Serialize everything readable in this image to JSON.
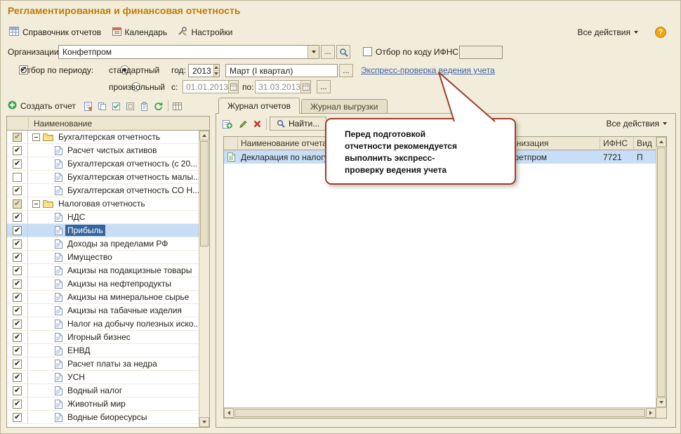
{
  "window": {
    "title": "Регламентированная и финансовая отчетность"
  },
  "top_toolbar": {
    "reports_catalog": "Справочник отчетов",
    "calendar": "Календарь",
    "settings": "Настройки",
    "all_actions": "Все действия",
    "help": "?"
  },
  "filters": {
    "org_label": "Организации:",
    "org_value": "Конфетпром",
    "ifns_check_label": "Отбор по коду ИФНС:",
    "ifns_value": "",
    "period_check_label": "Отбор по периоду:",
    "radio_standard": "стандартный",
    "radio_custom": "произвольный",
    "year_label": "год:",
    "year_value": "2013",
    "quarter_value": "Март (I квартал)",
    "from_label": "с:",
    "from_value": "01.01.2013",
    "to_label": "по:",
    "to_value": "31.03.2013",
    "dots": "...",
    "express_check_link": "Экспресс-проверка ведения учета"
  },
  "left_panel": {
    "create_button": "Создать отчет",
    "tree_header": "Наименование",
    "tree": [
      {
        "label": "Бухгалтерская отчетность",
        "level": 0,
        "type": "folder",
        "check": "partial",
        "selected": false
      },
      {
        "label": "Расчет чистых активов",
        "level": 1,
        "type": "doc",
        "check": "checked",
        "selected": false
      },
      {
        "label": "Бухгалтерская отчетность (с 20...",
        "level": 1,
        "type": "doc",
        "check": "checked",
        "selected": false
      },
      {
        "label": "Бухгалтерская отчетность малы...",
        "level": 1,
        "type": "doc",
        "check": "unchecked",
        "selected": false
      },
      {
        "label": "Бухгалтерская отчетность СО Н...",
        "level": 1,
        "type": "doc",
        "check": "checked",
        "selected": false
      },
      {
        "label": "Налоговая отчетность",
        "level": 0,
        "type": "folder",
        "check": "partial",
        "selected": false
      },
      {
        "label": "НДС",
        "level": 1,
        "type": "doc",
        "check": "checked",
        "selected": false
      },
      {
        "label": "Прибыль",
        "level": 1,
        "type": "doc",
        "check": "checked",
        "selected": true
      },
      {
        "label": "Доходы за пределами РФ",
        "level": 1,
        "type": "doc",
        "check": "checked",
        "selected": false
      },
      {
        "label": "Имущество",
        "level": 1,
        "type": "doc",
        "check": "checked",
        "selected": false
      },
      {
        "label": "Акцизы на подакцизные товары",
        "level": 1,
        "type": "doc",
        "check": "checked",
        "selected": false
      },
      {
        "label": "Акцизы на нефтепродукты",
        "level": 1,
        "type": "doc",
        "check": "checked",
        "selected": false
      },
      {
        "label": "Акцизы на минеральное сырье",
        "level": 1,
        "type": "doc",
        "check": "checked",
        "selected": false
      },
      {
        "label": "Акцизы на табачные изделия",
        "level": 1,
        "type": "doc",
        "check": "checked",
        "selected": false
      },
      {
        "label": "Налог на добычу полезных иско...",
        "level": 1,
        "type": "doc",
        "check": "checked",
        "selected": false
      },
      {
        "label": "Игорный бизнес",
        "level": 1,
        "type": "doc",
        "check": "checked",
        "selected": false
      },
      {
        "label": "ЕНВД",
        "level": 1,
        "type": "doc",
        "check": "checked",
        "selected": false
      },
      {
        "label": "Расчет платы за недра",
        "level": 1,
        "type": "doc",
        "check": "checked",
        "selected": false
      },
      {
        "label": "УСН",
        "level": 1,
        "type": "doc",
        "check": "checked",
        "selected": false
      },
      {
        "label": "Водный налог",
        "level": 1,
        "type": "doc",
        "check": "checked",
        "selected": false
      },
      {
        "label": "Животный мир",
        "level": 1,
        "type": "doc",
        "check": "checked",
        "selected": false
      },
      {
        "label": "Водные биоресурсы",
        "level": 1,
        "type": "doc",
        "check": "checked",
        "selected": false
      }
    ]
  },
  "right_panel": {
    "tabs": [
      "Журнал отчетов",
      "Журнал выгрузки"
    ],
    "find_button": "Найти...",
    "all_actions": "Все действия",
    "columns": [
      "",
      "Наименование отчета",
      "Организация",
      "ИФНС",
      "Вид"
    ],
    "rows": [
      {
        "name": "Декларация по налогу",
        "org": "Конфетпром",
        "ifns": "7721",
        "kind": "П"
      }
    ]
  },
  "callout": {
    "text": "Перед подготовкой отчетности рекомендуется выполнить экспресс-проверку ведения учета"
  }
}
